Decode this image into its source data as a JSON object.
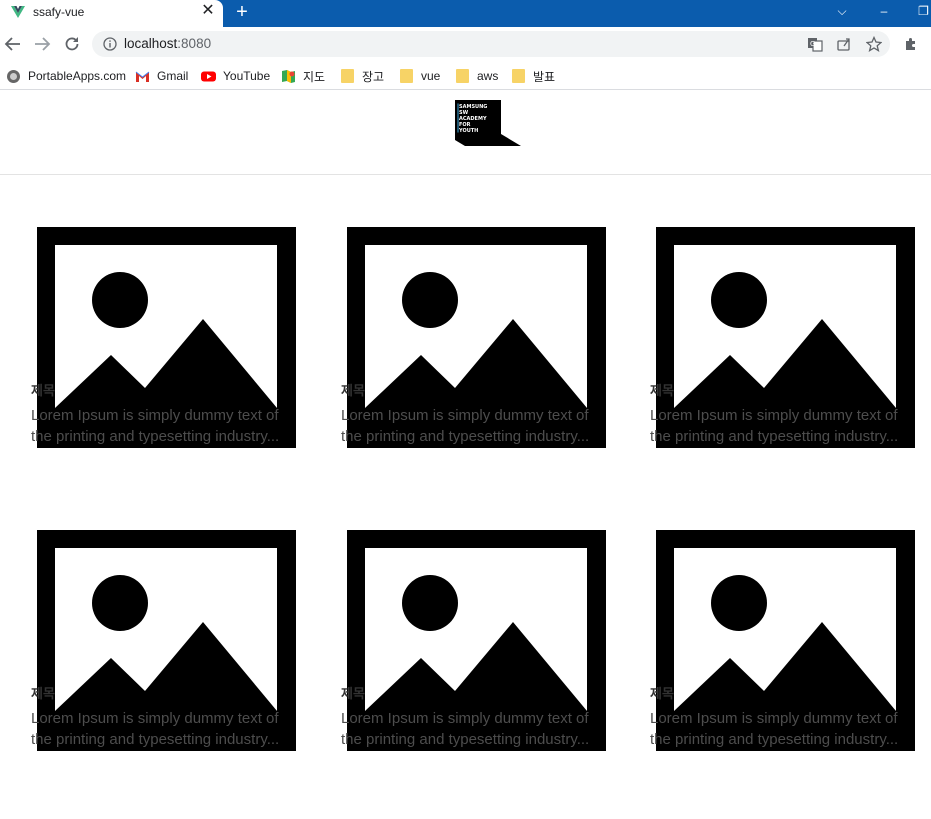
{
  "browser": {
    "tab": {
      "title": "ssafy-vue",
      "close": "✕"
    },
    "new_tab": "+",
    "window_controls": {
      "dropdown": "⌵",
      "minimize": "–",
      "restore": "❐"
    },
    "url": {
      "host": "localhost",
      "port": ":8080"
    },
    "accent": "#0b5cad"
  },
  "bookmarks": [
    {
      "label": "PortableApps.com",
      "icon": "portableapps-icon"
    },
    {
      "label": "Gmail",
      "icon": "gmail-icon"
    },
    {
      "label": "YouTube",
      "icon": "youtube-icon"
    },
    {
      "label": "지도",
      "icon": "maps-icon"
    },
    {
      "label": "장고",
      "icon": "folder-icon"
    },
    {
      "label": "vue",
      "icon": "folder-icon"
    },
    {
      "label": "aws",
      "icon": "folder-icon"
    },
    {
      "label": "발표",
      "icon": "folder-icon"
    }
  ],
  "header": {
    "logo_text": [
      "SAMSUNG",
      "SW",
      "ACADEMY",
      "FOR",
      "YOUTH"
    ]
  },
  "cards": [
    {
      "title": "제목",
      "text1": "Lorem Ipsum is simply dummy text of",
      "text2": "the printing and typesetting industry..."
    },
    {
      "title": "제목",
      "text1": "Lorem Ipsum is simply dummy text of",
      "text2": "the printing and typesetting industry..."
    },
    {
      "title": "제목",
      "text1": "Lorem Ipsum is simply dummy text of",
      "text2": "the printing and typesetting industry..."
    },
    {
      "title": "제목",
      "text1": "Lorem Ipsum is simply dummy text of",
      "text2": "the printing and typesetting industry..."
    },
    {
      "title": "제목",
      "text1": "Lorem Ipsum is simply dummy text of",
      "text2": "the printing and typesetting industry..."
    },
    {
      "title": "제목",
      "text1": "Lorem Ipsum is simply dummy text of",
      "text2": "the printing and typesetting industry..."
    }
  ]
}
